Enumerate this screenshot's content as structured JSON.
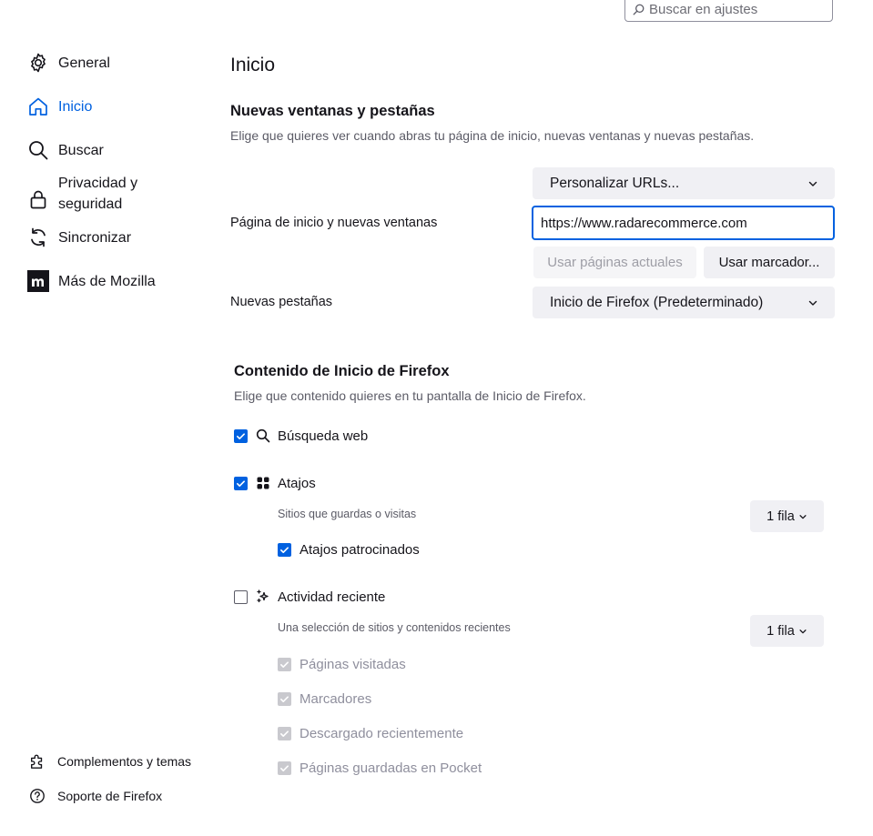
{
  "search": {
    "placeholder": "Buscar en ajustes"
  },
  "sidebar": {
    "items": [
      {
        "label": "General",
        "icon": "gear-icon"
      },
      {
        "label": "Inicio",
        "icon": "home-icon",
        "selected": true
      },
      {
        "label": "Buscar",
        "icon": "search-icon"
      },
      {
        "label": "Privacidad y seguridad",
        "icon": "lock-icon"
      },
      {
        "label": "Sincronizar",
        "icon": "sync-icon"
      },
      {
        "label": "Más de Mozilla",
        "icon": "mozilla-logo-icon"
      }
    ],
    "footer": [
      {
        "label": "Complementos y temas",
        "icon": "puzzle-icon"
      },
      {
        "label": "Soporte de Firefox",
        "icon": "help-icon"
      }
    ]
  },
  "main": {
    "title": "Inicio",
    "new_windows": {
      "heading": "Nuevas ventanas y pestañas",
      "description": "Elige que quieres ver cuando abras tu página de inicio, nuevas ventanas y nuevas pestañas.",
      "homepage_label": "Página de inicio y nuevas ventanas",
      "homepage_mode": "Personalizar URLs...",
      "homepage_url": "https://www.radarecommerce.com",
      "use_current_pages": "Usar páginas actuales",
      "use_bookmark": "Usar marcador...",
      "new_tabs_label": "Nuevas pestañas",
      "new_tabs_value": "Inicio de Firefox (Predeterminado)"
    },
    "home_content": {
      "heading": "Contenido de Inicio de Firefox",
      "description": "Elige que contenido quieres en tu pantalla de Inicio de Firefox.",
      "web_search": {
        "label": "Búsqueda web",
        "checked": true
      },
      "shortcuts": {
        "label": "Atajos",
        "checked": true,
        "description": "Sitios que guardas o visitas",
        "rows": "1 fila",
        "sponsored": {
          "label": "Atajos patrocinados",
          "checked": true
        }
      },
      "recent_activity": {
        "label": "Actividad reciente",
        "checked": false,
        "description": "Una selección de sitios y contenidos recientes",
        "rows": "1 fila",
        "options": [
          {
            "label": "Páginas visitadas",
            "checked": true,
            "disabled": true
          },
          {
            "label": "Marcadores",
            "checked": true,
            "disabled": true
          },
          {
            "label": "Descargado recientemente",
            "checked": true,
            "disabled": true
          },
          {
            "label": "Páginas guardadas en Pocket",
            "checked": true,
            "disabled": true
          }
        ]
      }
    }
  },
  "colors": {
    "accent": "#0061e0",
    "button_bg": "#f0f0f4",
    "text": "#15141a",
    "muted": "#5b5b66"
  }
}
